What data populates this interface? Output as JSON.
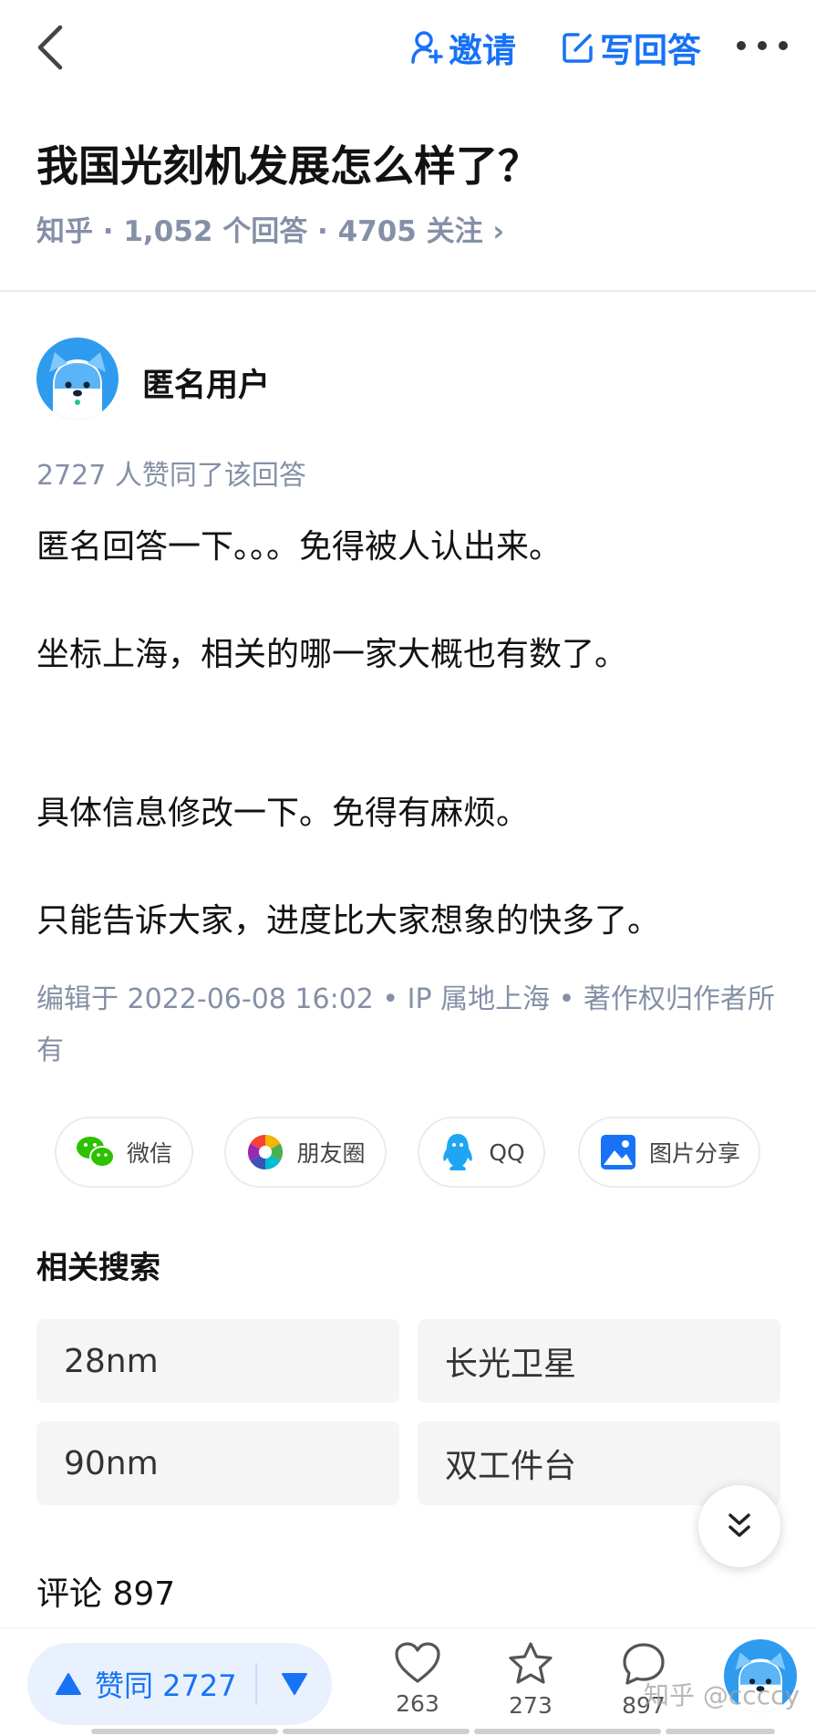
{
  "header": {
    "invite_label": "邀请",
    "write_answer_label": "写回答"
  },
  "question": {
    "title": "我国光刻机发展怎么样了？",
    "meta": "知乎 · 1,052 个回答 · 4705 关注 ›"
  },
  "answer": {
    "author_name": "匿名用户",
    "vote_summary": "2727 人赞同了该回答",
    "paragraphs": [
      "匿名回答一下。。。免得被人认出来。",
      "坐标上海，相关的哪一家大概也有数了。",
      "具体信息修改一下。免得有麻烦。",
      "只能告诉大家，进度比大家想象的快多了。"
    ],
    "edit_info": "编辑于 2022-06-08 16:02 • IP 属地上海 • 著作权归作者所有"
  },
  "share": {
    "wechat": "微信",
    "moments": "朋友圈",
    "qq": "QQ",
    "image_share": "图片分享"
  },
  "related": {
    "title": "相关搜索",
    "items": [
      "28nm",
      "长光卫星",
      "90nm",
      "双工件台"
    ]
  },
  "comments": {
    "title": "评论 897"
  },
  "bottom_bar": {
    "upvote_label": "赞同 2727",
    "like_count": "263",
    "favorite_count": "273",
    "comment_count": "897",
    "watermark": "知乎 @ccccy"
  },
  "colors": {
    "accent": "#1772f6",
    "meta_gray": "#8590a6",
    "avatar_blue": "#2e9bef"
  }
}
